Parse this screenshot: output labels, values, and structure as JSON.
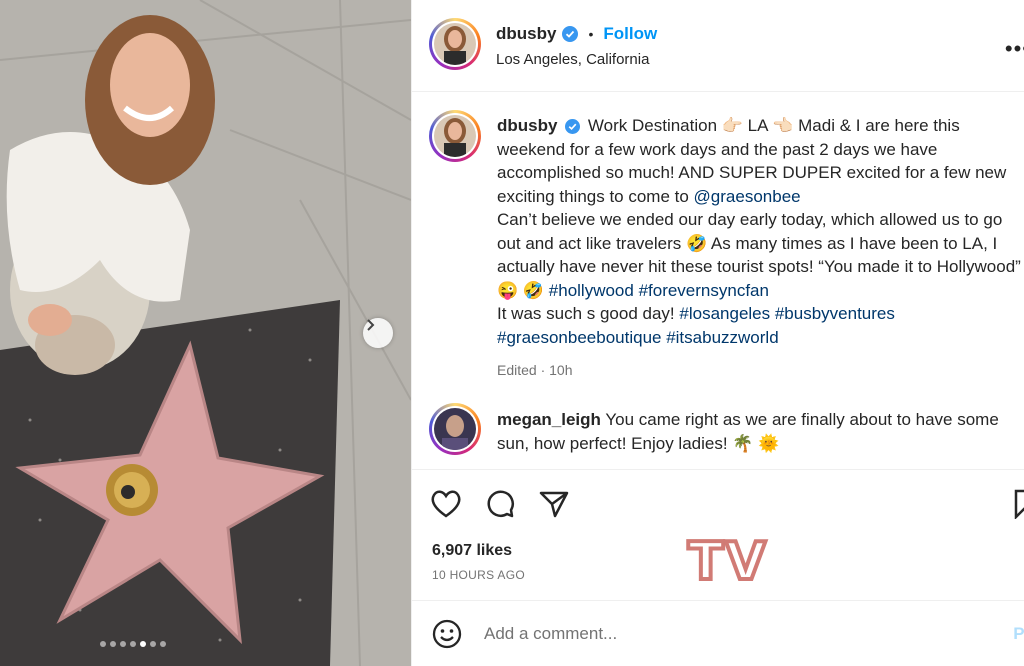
{
  "post": {
    "username": "dbusby",
    "follow_label": "Follow",
    "separator": "•",
    "location": "Los Angeles, California"
  },
  "caption": {
    "username": "dbusby",
    "part1": "Work Destination 👉🏻 LA 👈🏻 Madi & I are here this weekend for a few work days and the past 2 days we have accomplished so much! AND SUPER DUPER excited for a few new exciting things to come to ",
    "mention": "@graesonbee",
    "part2": "Can’t believe we ended our day early today, which allowed us to go out and act like travelers 🤣 As many times as I have been to LA, I actually have never hit these tourist spots! “You made it to Hollywood” 😜 🤣 ",
    "tags1": "#hollywood #forevernsyncfan",
    "part3": "It was such s good day! ",
    "tags2": "#losangeles #busbyventures",
    "tags3": "#graesonbeeboutique #itsabuzzworld",
    "edited": "Edited · 10h"
  },
  "comment": {
    "username": "megan_leigh",
    "text": "You came right as we are finally about to have some sun, how perfect! Enjoy ladies! 🌴 🌞"
  },
  "stats": {
    "likes": "6,907 likes",
    "time": "10 HOURS AGO"
  },
  "add_comment": {
    "placeholder": "Add a comment...",
    "post_label": "Po"
  },
  "watermark": "TV",
  "icons": [
    "verified-badge-icon",
    "more-options-icon",
    "heart-icon",
    "comment-icon",
    "share-icon",
    "save-icon",
    "emoji-icon",
    "chevron-right-icon"
  ],
  "colors": {
    "accent": "#0095f6",
    "link": "#00376b",
    "watermark": "#d17b75"
  }
}
